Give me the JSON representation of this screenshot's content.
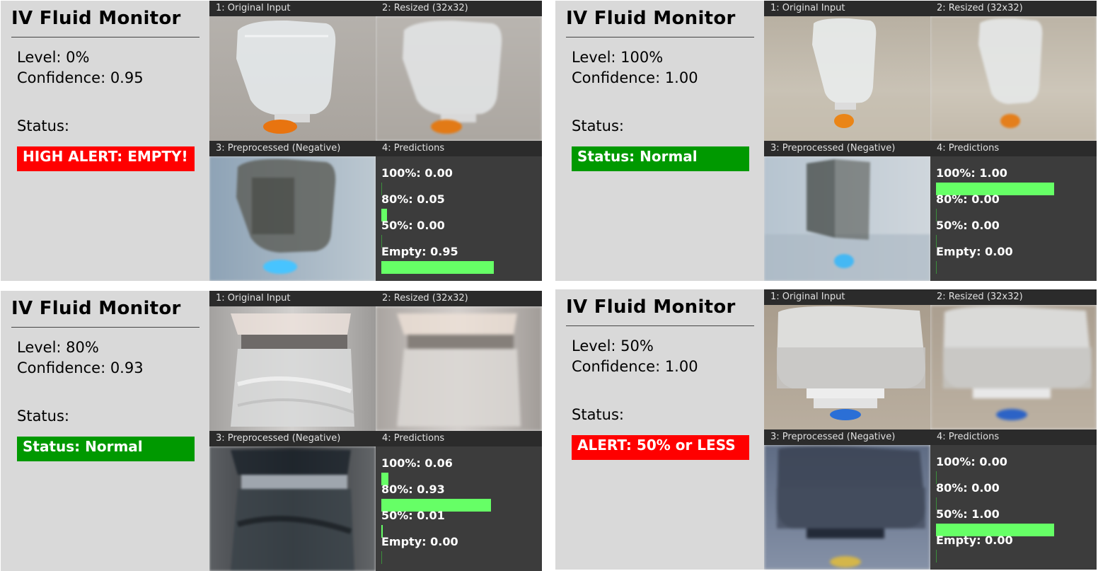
{
  "panels": [
    {
      "title": "IV Fluid Monitor",
      "level": "Level: 0%",
      "confidence": "Confidence: 0.95",
      "status_label": "Status:",
      "status_text": "HIGH ALERT: EMPTY!",
      "status_color": "#ff0000",
      "cell_titles": [
        "1: Original Input",
        "2: Resized (32x32)",
        "3: Preprocessed (Negative)",
        "4: Predictions"
      ],
      "predictions": [
        {
          "label": "100%: 0.00",
          "value": 0.0
        },
        {
          "label": "80%: 0.05",
          "value": 0.05
        },
        {
          "label": "50%: 0.00",
          "value": 0.0
        },
        {
          "label": "Empty: 0.95",
          "value": 0.95
        }
      ]
    },
    {
      "title": "IV Fluid Monitor",
      "level": "Level: 100%",
      "confidence": "Confidence: 1.00",
      "status_label": "Status:",
      "status_text": "Status: Normal",
      "status_color": "#009900",
      "cell_titles": [
        "1: Original Input",
        "2: Resized (32x32)",
        "3: Preprocessed (Negative)",
        "4: Predictions"
      ],
      "predictions": [
        {
          "label": "100%: 1.00",
          "value": 1.0
        },
        {
          "label": "80%: 0.00",
          "value": 0.0
        },
        {
          "label": "50%: 0.00",
          "value": 0.0
        },
        {
          "label": "Empty: 0.00",
          "value": 0.0
        }
      ]
    },
    {
      "title": "IV Fluid Monitor",
      "level": "Level: 80%",
      "confidence": "Confidence: 0.93",
      "status_label": "Status:",
      "status_text": "Status: Normal",
      "status_color": "#009900",
      "cell_titles": [
        "1: Original Input",
        "2: Resized (32x32)",
        "3: Preprocessed (Negative)",
        "4: Predictions"
      ],
      "predictions": [
        {
          "label": "100%: 0.06",
          "value": 0.06
        },
        {
          "label": "80%: 0.93",
          "value": 0.93
        },
        {
          "label": "50%: 0.01",
          "value": 0.01
        },
        {
          "label": "Empty: 0.00",
          "value": 0.0
        }
      ]
    },
    {
      "title": "IV Fluid Monitor",
      "level": "Level: 50%",
      "confidence": "Confidence: 1.00",
      "status_label": "Status:",
      "status_text": "ALERT: 50% or LESS",
      "status_color": "#ff0000",
      "cell_titles": [
        "1: Original Input",
        "2: Resized (32x32)",
        "3: Preprocessed (Negative)",
        "4: Predictions"
      ],
      "predictions": [
        {
          "label": "100%: 0.00",
          "value": 0.0
        },
        {
          "label": "80%: 0.00",
          "value": 0.0
        },
        {
          "label": "50%: 1.00",
          "value": 1.0
        },
        {
          "label": "Empty: 0.00",
          "value": 0.0
        }
      ]
    }
  ],
  "colors": {
    "bar": "#66ff66",
    "panel_bg": "#d9d9d9",
    "prediction_bg": "#3c3c3c"
  }
}
